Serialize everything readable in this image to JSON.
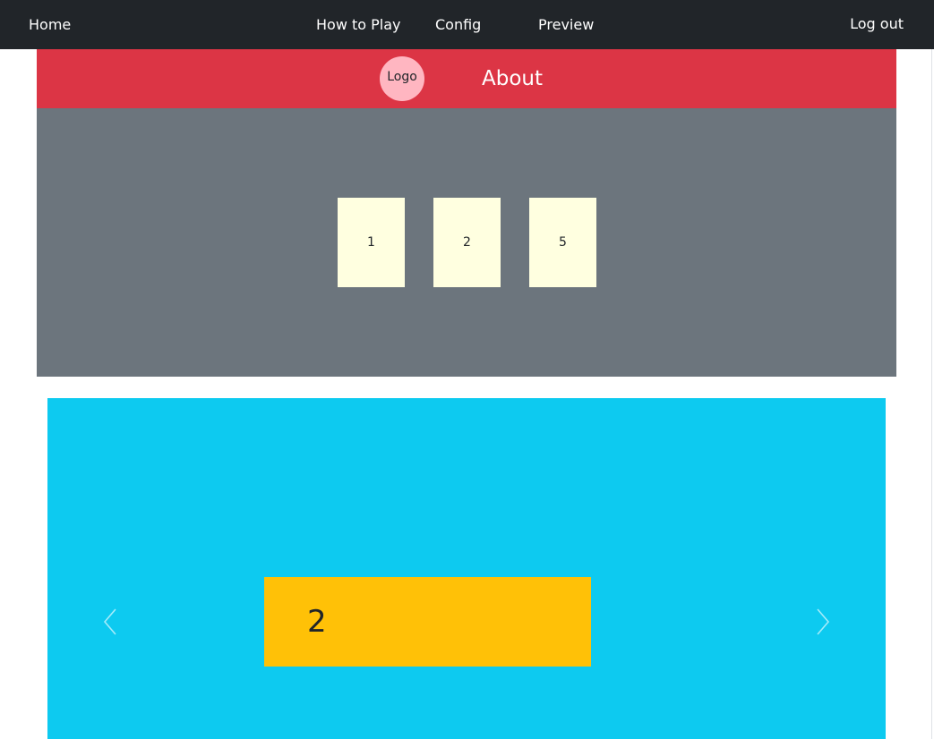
{
  "navbar": {
    "home": "Home",
    "how_to_play": "How to Play",
    "config": "Config",
    "preview": "Preview",
    "logout": "Log out"
  },
  "header": {
    "logo": "Logo",
    "title": "About"
  },
  "cards": [
    "1",
    "2",
    "5"
  ],
  "carousel": {
    "slide_text": "2",
    "prev_icon": "chevron-left-icon",
    "next_icon": "chevron-right-icon"
  },
  "colors": {
    "navbar": "#212529",
    "header": "#dc3545",
    "logo": "#ffb6c1",
    "card_area": "#6c757d",
    "card": "#ffffe0",
    "carousel": "#0dcaf0",
    "slide": "#ffc107"
  }
}
